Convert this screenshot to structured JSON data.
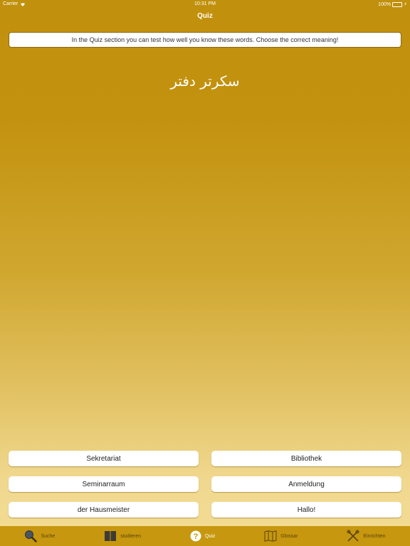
{
  "status_bar": {
    "carrier": "Carrier",
    "time": "10:31 PM",
    "battery": "100%"
  },
  "nav": {
    "title": "Quiz"
  },
  "info_banner": {
    "text": "In the Quiz section you can test how well you know these words. Choose the correct meaning!"
  },
  "question": {
    "word": "سکرتر دفتر"
  },
  "answers": [
    "Sekretariat",
    "Bibliothek",
    "Seminarraum",
    "Anmeldung",
    "der Hausmeister",
    "Hallo!"
  ],
  "tabs": [
    {
      "label": "Suche",
      "icon": "search-icon"
    },
    {
      "label": "studieren",
      "icon": "book-icon"
    },
    {
      "label": "Quiz",
      "icon": "question-icon",
      "active": true
    },
    {
      "label": "Glossar",
      "icon": "map-icon"
    },
    {
      "label": "Einrichten",
      "icon": "tools-icon"
    }
  ],
  "colors": {
    "accent": "#c1900c",
    "tab_bar": "#c7970f",
    "tab_inactive": "#5a4208"
  }
}
